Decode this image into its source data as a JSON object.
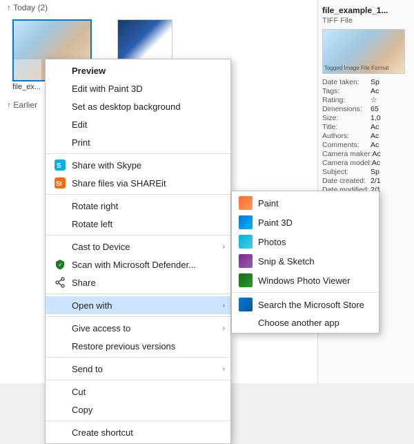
{
  "explorer": {
    "today_label": "↑ Today (2)",
    "earlier_label": "↑ Earlier",
    "file1_label": "file_ex...",
    "file2_label": ""
  },
  "right_panel": {
    "file_title": "file_example_1...",
    "file_type": "TIFF File",
    "thumbnail_alt": "Tagged Image File Format",
    "properties": [
      {
        "key": "Date taken:",
        "val": "Sp"
      },
      {
        "key": "Tags:",
        "val": "Ac"
      },
      {
        "key": "Rating:",
        "val": "☆"
      },
      {
        "key": "Dimensions:",
        "val": "65"
      },
      {
        "key": "Size:",
        "val": "1,0"
      },
      {
        "key": "Title:",
        "val": "Ac"
      },
      {
        "key": "Authors:",
        "val": "Ac"
      },
      {
        "key": "Comments:",
        "val": "Ac"
      },
      {
        "key": "Camera maker:",
        "val": "Ac"
      },
      {
        "key": "Camera model:",
        "val": "Ac"
      },
      {
        "key": "Subject:",
        "val": "Sp"
      },
      {
        "key": "Date created:",
        "val": "2/1"
      },
      {
        "key": "Date modified:",
        "val": "2/1"
      }
    ]
  },
  "context_menu": {
    "items": [
      {
        "label": "Preview",
        "bold": true,
        "icon": "preview",
        "has_arrow": false
      },
      {
        "label": "Edit with Paint 3D",
        "bold": false,
        "icon": "",
        "has_arrow": false
      },
      {
        "label": "Set as desktop background",
        "bold": false,
        "icon": "",
        "has_arrow": false
      },
      {
        "label": "Edit",
        "bold": false,
        "icon": "",
        "has_arrow": false
      },
      {
        "label": "Print",
        "bold": false,
        "icon": "",
        "has_arrow": false
      },
      {
        "separator": true
      },
      {
        "label": "Share with Skype",
        "bold": false,
        "icon": "skype",
        "has_arrow": false
      },
      {
        "label": "Share files via SHAREit",
        "bold": false,
        "icon": "shareit",
        "has_arrow": false
      },
      {
        "separator": true
      },
      {
        "label": "Rotate right",
        "bold": false,
        "icon": "",
        "has_arrow": false
      },
      {
        "label": "Rotate left",
        "bold": false,
        "icon": "",
        "has_arrow": false
      },
      {
        "separator": true
      },
      {
        "label": "Cast to Device",
        "bold": false,
        "icon": "",
        "has_arrow": true
      },
      {
        "label": "Scan with Microsoft Defender...",
        "bold": false,
        "icon": "defender",
        "has_arrow": false
      },
      {
        "label": "Share",
        "bold": false,
        "icon": "share",
        "has_arrow": false
      },
      {
        "separator": true
      },
      {
        "label": "Open with",
        "bold": false,
        "icon": "",
        "has_arrow": true,
        "highlighted": true
      },
      {
        "separator": true
      },
      {
        "label": "Give access to",
        "bold": false,
        "icon": "",
        "has_arrow": true
      },
      {
        "label": "Restore previous versions",
        "bold": false,
        "icon": "",
        "has_arrow": false
      },
      {
        "separator": true
      },
      {
        "label": "Send to",
        "bold": false,
        "icon": "",
        "has_arrow": true
      },
      {
        "separator": true
      },
      {
        "label": "Cut",
        "bold": false,
        "icon": "",
        "has_arrow": false
      },
      {
        "label": "Copy",
        "bold": false,
        "icon": "",
        "has_arrow": false
      },
      {
        "separator": true
      },
      {
        "label": "Create shortcut",
        "bold": false,
        "icon": "",
        "has_arrow": false
      }
    ]
  },
  "submenu_openwith": {
    "items": [
      {
        "label": "Paint",
        "icon": "paint"
      },
      {
        "label": "Paint 3D",
        "icon": "paint3d"
      },
      {
        "label": "Photos",
        "icon": "photos"
      },
      {
        "label": "Snip & Sketch",
        "icon": "snip"
      },
      {
        "label": "Windows Photo Viewer",
        "icon": "photoviewer"
      }
    ],
    "separator": true,
    "extra_items": [
      {
        "label": "Search the Microsoft Store",
        "icon": "store"
      },
      {
        "label": "Choose another app",
        "icon": ""
      }
    ]
  }
}
